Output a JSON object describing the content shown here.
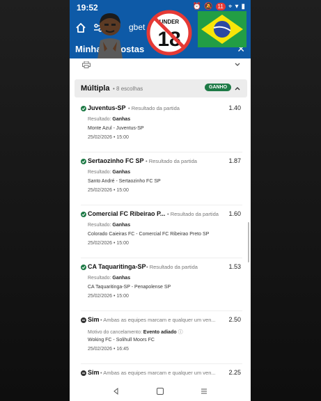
{
  "status_bar": {
    "time": "19:52",
    "notification_count": "11"
  },
  "app_bar": {
    "site_label": "gbet",
    "title": "Minhas Apostas"
  },
  "bet_section": {
    "type_label": "Múltipla",
    "count_label": "8 escolhas",
    "status_badge": "GANHO"
  },
  "selections": [
    {
      "pick": "Juventus-SP",
      "market": "Resultado da partida",
      "odd": "1.40",
      "result_label": "Resultado:",
      "result_value": "Ganhas",
      "match": "Monte Azul - Juventus-SP",
      "datetime": "25/02/2026 • 15:00",
      "status": "won"
    },
    {
      "pick": "Sertaozinho FC SP",
      "market": "Resultado da partida",
      "odd": "1.87",
      "result_label": "Resultado:",
      "result_value": "Ganhas",
      "match": "Santo André - Sertaozinho FC SP",
      "datetime": "25/02/2026 • 15:00",
      "status": "won"
    },
    {
      "pick": "Comercial FC Ribeirao P...",
      "market": "Resultado da partida",
      "odd": "1.60",
      "result_label": "Resultado:",
      "result_value": "Ganhas",
      "match": "Colorado Caieiras FC - Comercial FC Ribeirao Preto SP",
      "datetime": "25/02/2026 • 15:00",
      "status": "won"
    },
    {
      "pick": "CA Taquaritinga-SP",
      "market": "Resultado da partida",
      "odd": "1.53",
      "result_label": "Resultado:",
      "result_value": "Ganhas",
      "match": "CA Taquaritinga-SP - Penapolense SP",
      "datetime": "25/02/2026 • 15:00",
      "status": "won"
    },
    {
      "pick": "Sim",
      "market": "Ambas as equipes marcam e qualquer um ven...",
      "odd": "2.50",
      "result_label": "Motivo do cancelamento:",
      "result_value": "Evento adiado",
      "match": "Woking FC - Solihull Moors FC",
      "datetime": "25/02/2026 • 16:45",
      "status": "void"
    },
    {
      "pick": "Sim",
      "market": "Ambas as equipes marcam e qualquer um ven...",
      "odd": "2.25",
      "status": "void"
    }
  ],
  "colors": {
    "brand_blue": "#0e5aa7",
    "won_green": "#1e7a46",
    "header_grey": "#ececec"
  }
}
